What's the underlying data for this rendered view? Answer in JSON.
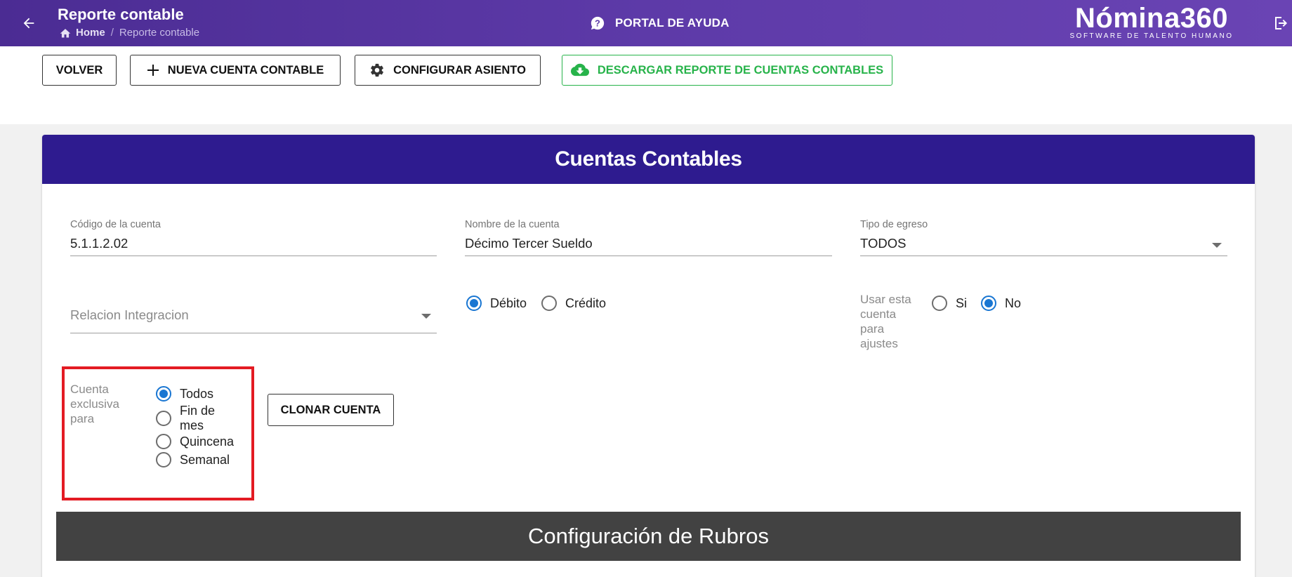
{
  "header": {
    "title": "Reporte contable",
    "breadcrumb_home": "Home",
    "breadcrumb_sep": "/",
    "breadcrumb_current": "Reporte contable",
    "help_label": "PORTAL DE AYUDA",
    "logo_name": "Nómina360",
    "logo_tagline": "SOFTWARE DE TALENTO HUMANO"
  },
  "toolbar": {
    "back_label": "VOLVER",
    "new_account_label": "NUEVA CUENTA CONTABLE",
    "configure_label": "CONFIGURAR ASIENTO",
    "download_label": "DESCARGAR REPORTE DE CUENTAS CONTABLES"
  },
  "card": {
    "title": "Cuentas Contables",
    "account_code": {
      "label": "Código de la cuenta",
      "value": "5.1.1.2.02"
    },
    "account_name": {
      "label": "Nombre de la cuenta",
      "value": "Décimo Tercer Sueldo"
    },
    "expense_type": {
      "label": "Tipo de egreso",
      "value": "TODOS"
    },
    "integration": {
      "placeholder": "Relacion Integracion"
    },
    "nature": {
      "debit": "Débito",
      "credit": "Crédito",
      "selected": "Débito"
    },
    "adjust": {
      "label_lines": [
        "Usar esta",
        "cuenta",
        "para",
        "ajustes"
      ],
      "yes": "Si",
      "no": "No",
      "selected": "No"
    },
    "exclusive": {
      "label_lines": [
        "Cuenta",
        "exclusiva",
        "para"
      ],
      "options": [
        "Todos",
        "Fin de mes",
        "Quincena",
        "Semanal"
      ],
      "option_lines": {
        "fin_1": "Fin de",
        "fin_2": "mes"
      },
      "selected": "Todos"
    },
    "clone_label": "CLONAR CUENTA",
    "rubros_title": "Configuración de Rubros"
  },
  "colors": {
    "topbar": "#5d3aa8",
    "card_header": "#2e1b8f",
    "accent_blue": "#1976d2",
    "download_green": "#27b34a",
    "highlight_red": "#e31b23",
    "sub_header": "#424242"
  }
}
